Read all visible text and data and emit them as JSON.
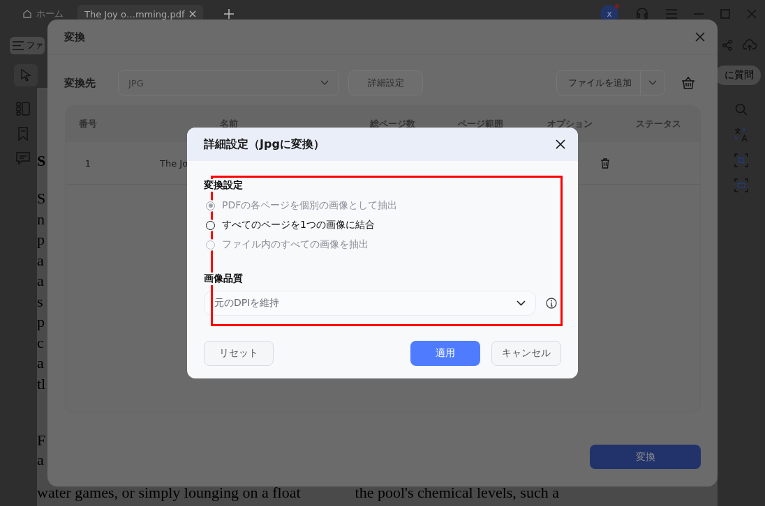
{
  "app_tabs": [
    {
      "label": "ホーム",
      "kind": "home",
      "selected": false
    },
    {
      "label": "The Joy o…mming.pdf",
      "kind": "file",
      "selected": true
    }
  ],
  "avatar": {
    "initial": "x"
  },
  "toolbar": {
    "menu_label": "ファ",
    "ask_label": "に質問"
  },
  "document": {
    "heading": "S",
    "line_starts": [
      "S",
      "n",
      "p",
      "a",
      "a",
      "s",
      "p",
      "c",
      "a",
      "tl"
    ],
    "paragraph_starts": [
      "F",
      "a"
    ],
    "bottom_left": "water games, or simply lounging on a float",
    "bottom_right": "the pool's chemical levels, such a"
  },
  "convert_dialog": {
    "title": "変換",
    "target_label": "変換先",
    "format": "JPG",
    "settings_button": "詳細設定",
    "add_file_button": "ファイルを追加",
    "columns": [
      "番号",
      "名前",
      "総ページ数",
      "ページ範囲",
      "オプション",
      "ステータス"
    ],
    "rows": [
      {
        "number": "1",
        "name": "The Jo"
      }
    ],
    "convert_button": "変換"
  },
  "settings_dialog": {
    "title": "詳細設定（Jpgに変換）",
    "section_label": "変換設定",
    "options": [
      {
        "label": "PDFの各ページを個別の画像として抽出",
        "selected": true,
        "hovered": false
      },
      {
        "label": "すべてのページを1つの画像に結合",
        "selected": false,
        "hovered": true
      },
      {
        "label": "ファイル内のすべての画像を抽出",
        "selected": false,
        "hovered": false
      }
    ],
    "quality_label": "画像品質",
    "quality": "元のDPIを維持",
    "reset_button": "リセット",
    "apply_button": "適用",
    "cancel_button": "キャンセル"
  }
}
